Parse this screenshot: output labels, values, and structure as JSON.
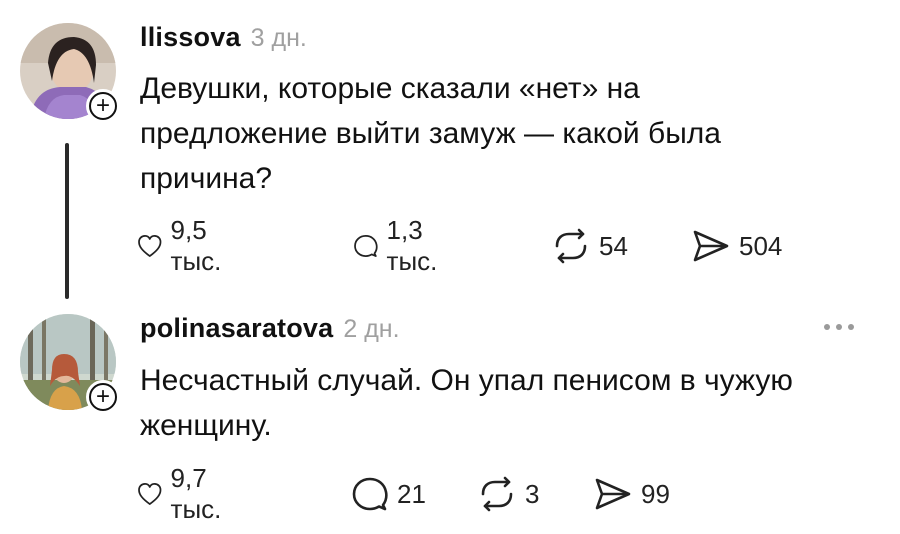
{
  "posts": [
    {
      "username": "llissova",
      "time": "3 дн.",
      "text": "Девушки, которые сказали «нет» на\nпредложение выйти замуж — какой была\nпричина?",
      "follow_symbol": "+",
      "likes": "9,5 тыс.",
      "replies": "1,3 тыс.",
      "reposts": "54",
      "shares": "504"
    },
    {
      "username": "polinasaratova",
      "time": "2 дн.",
      "text": "Несчастный случай. Он упал пенисом в чужую\nженщину.",
      "follow_symbol": "+",
      "likes": "9,7 тыс.",
      "replies": "21",
      "reposts": "3",
      "shares": "99"
    }
  ],
  "icons": {
    "like": "heart-icon",
    "reply": "comment-bubble-icon",
    "repost": "repost-arrows-icon",
    "share": "send-paper-plane-icon",
    "more": "more-dots-icon",
    "follow": "plus-icon"
  },
  "colors": {
    "text": "#111111",
    "muted": "#a0a0a0",
    "background": "#ffffff"
  }
}
